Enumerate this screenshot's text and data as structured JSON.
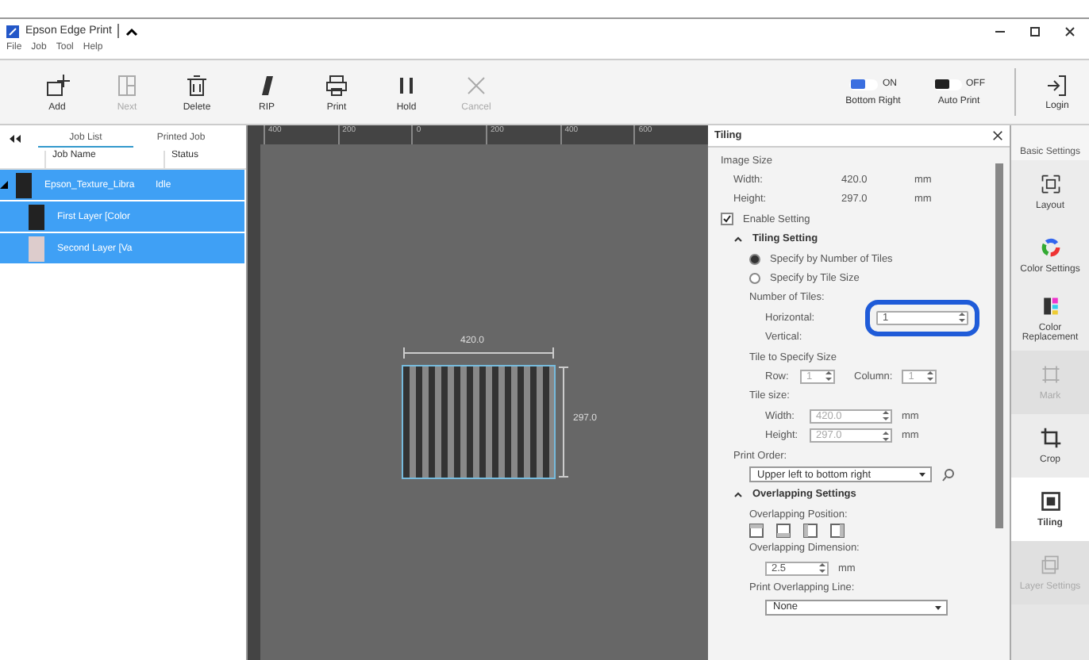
{
  "window": {
    "title": "Epson Edge Print"
  },
  "menu": [
    "File",
    "Job",
    "Tool",
    "Help"
  ],
  "toolbar": [
    {
      "label": "Add",
      "kind": "add",
      "disabled": false
    },
    {
      "label": "Next",
      "kind": "next",
      "disabled": true
    },
    {
      "label": "Delete",
      "kind": "delete",
      "disabled": false
    },
    {
      "label": "RIP",
      "kind": "rip",
      "disabled": false
    },
    {
      "label": "Print",
      "kind": "print",
      "disabled": false
    },
    {
      "label": "Hold",
      "kind": "hold",
      "disabled": false
    },
    {
      "label": "Cancel",
      "kind": "cancel",
      "disabled": true
    }
  ],
  "toggles": [
    {
      "state_label": "ON",
      "label": "Bottom Right",
      "on": true
    },
    {
      "state_label": "OFF",
      "label": "Auto Print",
      "on": false
    }
  ],
  "login": "Login",
  "job_panel": {
    "tabs": [
      {
        "label": "Job List",
        "selected": true
      },
      {
        "label": "Printed Job",
        "selected": false
      }
    ],
    "columns": [
      "Job Name",
      "Status"
    ],
    "rows": [
      {
        "name": "Epson_Texture_Libra",
        "status": "Idle",
        "selected": true,
        "expanded": true,
        "children": [
          {
            "name": "First Layer [Color",
            "selected": true
          },
          {
            "name": "Second Layer [Va",
            "selected": true
          }
        ]
      }
    ]
  },
  "canvas": {
    "ruler_labels": [
      "400",
      "200",
      "0",
      "200",
      "400",
      "600"
    ],
    "width_label": "420.0",
    "height_label": "297.0"
  },
  "tiling": {
    "title": "Tiling",
    "image_size": "Image Size",
    "size_rows": [
      {
        "label": "Width:",
        "value": "420.0",
        "unit": "mm"
      },
      {
        "label": "Height:",
        "value": "297.0",
        "unit": "mm"
      }
    ],
    "enable_setting": {
      "label": "Enable Setting",
      "checked": true
    },
    "tiling_setting": {
      "title": "Tiling Setting",
      "expanded": true
    },
    "options": [
      {
        "label": "Specify by Number of Tiles",
        "selected": true
      },
      {
        "label": "Specify by Tile Size",
        "selected": false
      }
    ],
    "number_of_tiles": "Number of Tiles:",
    "horizontal": {
      "label": "Horizontal:",
      "value": "1",
      "highlighted": true
    },
    "vertical": {
      "label": "Vertical:"
    },
    "tile_to_specify_size": "Tile to Specify Size",
    "row": {
      "label": "Row:",
      "value": "1",
      "disabled": true
    },
    "column": {
      "label": "Column:",
      "value": "1",
      "disabled": true
    },
    "tile_size": "Tile size:",
    "tile_rows": [
      {
        "label": "Width:",
        "value": "420.0",
        "unit": "mm",
        "disabled": true
      },
      {
        "label": "Height:",
        "value": "297.0",
        "unit": "mm",
        "disabled": true
      }
    ],
    "print_order": {
      "label": "Print Order:",
      "value": "Upper left to bottom right"
    },
    "overlapping_settings": {
      "title": "Overlapping Settings",
      "expanded": true
    },
    "overlapping_position": "Overlapping Position:",
    "overlapping_dimension": {
      "label": "Overlapping Dimension:",
      "value": "2.5",
      "unit": "mm"
    },
    "print_overlapping_line": {
      "label": "Print Overlapping Line:",
      "value": "None"
    }
  },
  "sidebar": {
    "header": "Basic Settings",
    "items": [
      {
        "label": "Layout",
        "kind": "layout",
        "selected": false,
        "disabled": false
      },
      {
        "label": "Color Settings",
        "kind": "color",
        "selected": false,
        "disabled": false
      },
      {
        "label": "Color Replacement",
        "kind": "replace",
        "selected": false,
        "disabled": false
      },
      {
        "label": "Mark",
        "kind": "mark",
        "selected": false,
        "disabled": true
      },
      {
        "label": "Crop",
        "kind": "crop",
        "selected": false,
        "disabled": false
      },
      {
        "label": "Tiling",
        "kind": "tiling",
        "selected": true,
        "disabled": false
      },
      {
        "label": "Layer Settings",
        "kind": "layer",
        "selected": false,
        "disabled": true
      }
    ]
  }
}
